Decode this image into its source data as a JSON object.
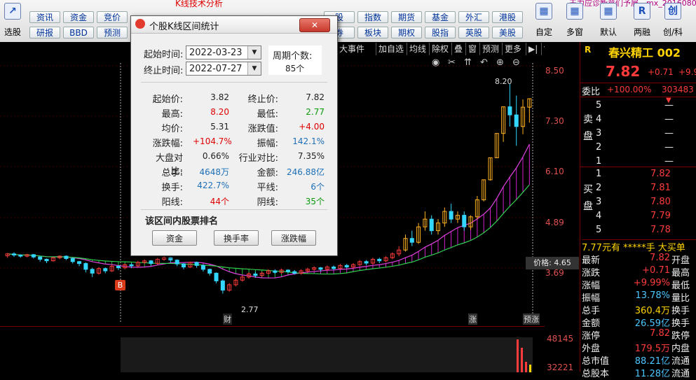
{
  "window_title": "K线技术分析",
  "toolbar": {
    "left_tool": {
      "label": "选股",
      "icon": "chart-line-icon"
    },
    "row1": [
      "资讯",
      "资金",
      "竞价",
      "",
      "",
      "股",
      "指数",
      "期货",
      "基金",
      "外汇",
      "港股"
    ],
    "row2": [
      "研报",
      "BBD",
      "预测",
      "",
      "",
      "券",
      "板块",
      "期权",
      "股指",
      "英股",
      "美股"
    ],
    "big": [
      {
        "label": "自定",
        "icon": "custom-layout-icon"
      },
      {
        "label": "多窗",
        "icon": "multi-window-icon"
      },
      {
        "label": "默认",
        "icon": "default-settings-icon"
      },
      {
        "label": "两融",
        "icon": "margin-trading-icon",
        "glyph": "R"
      },
      {
        "label": "创/科",
        "icon": "star-board-icon",
        "glyph": "创"
      }
    ],
    "top_right_text": "王力应诊断意们予展　mx_2016080"
  },
  "chart_controls": [
    "大事件",
    "加自选",
    "均线",
    "除权",
    "叠",
    "窗",
    "预测",
    "更多"
  ],
  "chart_icons": [
    "eye-icon",
    "scissors-icon",
    "up-arrows-icon",
    "undo-icon",
    "zoom-in-icon",
    "zoom-out-icon"
  ],
  "price_axis": [
    "8.50",
    "7.30",
    "6.10",
    "4.89",
    "3.69"
  ],
  "vol_axis": [
    "48145",
    "32221"
  ],
  "chart_labels": {
    "high_marker": "8.20",
    "low_marker": "2.77",
    "price_tip": "价格: 4.65",
    "b_marker": "B",
    "cai_marker": "财",
    "zhang_marker": "涨",
    "zhang2_marker": "预涨"
  },
  "chart_data": {
    "type": "candlestick",
    "y_range": [
      2.4,
      8.6
    ],
    "candles": [
      [
        3.75,
        3.8,
        3.7,
        3.82
      ],
      [
        3.8,
        3.77,
        3.72,
        3.84
      ],
      [
        3.77,
        3.74,
        3.7,
        3.79
      ],
      [
        3.74,
        3.78,
        3.71,
        3.8
      ],
      [
        3.78,
        3.72,
        3.68,
        3.8
      ],
      [
        3.72,
        3.66,
        3.6,
        3.74
      ],
      [
        3.66,
        3.62,
        3.56,
        3.68
      ],
      [
        3.62,
        3.7,
        3.6,
        3.72
      ],
      [
        3.7,
        3.74,
        3.66,
        3.76
      ],
      [
        3.74,
        3.68,
        3.64,
        3.76
      ],
      [
        3.68,
        3.6,
        3.55,
        3.7
      ],
      [
        3.6,
        3.55,
        3.48,
        3.62
      ],
      [
        3.55,
        3.4,
        3.32,
        3.58
      ],
      [
        3.4,
        3.3,
        3.2,
        3.44
      ],
      [
        3.3,
        3.42,
        3.26,
        3.46
      ],
      [
        3.42,
        3.36,
        3.3,
        3.45
      ],
      [
        3.36,
        3.48,
        3.33,
        3.52
      ],
      [
        3.48,
        3.44,
        3.38,
        3.5
      ],
      [
        3.44,
        3.52,
        3.4,
        3.55
      ],
      [
        3.52,
        3.49,
        3.43,
        3.56
      ],
      [
        3.49,
        3.58,
        3.46,
        3.62
      ],
      [
        3.58,
        3.62,
        3.54,
        3.66
      ],
      [
        3.62,
        3.55,
        3.5,
        3.64
      ],
      [
        3.55,
        3.66,
        3.52,
        3.7
      ],
      [
        3.66,
        3.7,
        3.62,
        3.74
      ],
      [
        3.7,
        3.64,
        3.58,
        3.72
      ],
      [
        3.64,
        3.54,
        3.48,
        3.66
      ],
      [
        3.54,
        3.46,
        3.4,
        3.56
      ],
      [
        3.46,
        3.58,
        3.44,
        3.6
      ],
      [
        3.58,
        3.5,
        3.44,
        3.6
      ],
      [
        3.5,
        3.4,
        3.34,
        3.52
      ],
      [
        3.4,
        3.3,
        3.24,
        3.42
      ],
      [
        3.3,
        3.1,
        3.04,
        3.32
      ],
      [
        3.1,
        2.86,
        2.77,
        3.14
      ],
      [
        2.86,
        3.0,
        2.82,
        3.04
      ],
      [
        3.0,
        3.12,
        2.96,
        3.16
      ],
      [
        3.12,
        3.2,
        3.08,
        3.24
      ],
      [
        3.2,
        3.28,
        3.16,
        3.32
      ],
      [
        3.28,
        3.24,
        3.18,
        3.34
      ],
      [
        3.24,
        3.3,
        3.2,
        3.34
      ],
      [
        3.3,
        3.36,
        3.26,
        3.4
      ],
      [
        3.36,
        3.32,
        3.28,
        3.4
      ],
      [
        3.32,
        3.38,
        3.28,
        3.42
      ],
      [
        3.38,
        3.34,
        3.3,
        3.4
      ],
      [
        3.34,
        3.3,
        3.26,
        3.38
      ],
      [
        3.3,
        3.36,
        3.26,
        3.4
      ],
      [
        3.36,
        3.4,
        3.32,
        3.44
      ],
      [
        3.4,
        3.44,
        3.36,
        3.48
      ],
      [
        3.44,
        3.4,
        3.34,
        3.46
      ],
      [
        3.4,
        3.46,
        3.36,
        3.5
      ],
      [
        3.46,
        3.42,
        3.38,
        3.5
      ],
      [
        3.42,
        3.5,
        3.4,
        3.54
      ],
      [
        3.5,
        3.46,
        3.42,
        3.54
      ],
      [
        3.46,
        3.52,
        3.42,
        3.56
      ],
      [
        3.52,
        3.6,
        3.48,
        3.64
      ],
      [
        3.6,
        3.56,
        3.5,
        3.64
      ],
      [
        3.56,
        3.66,
        3.52,
        3.7
      ],
      [
        3.66,
        3.62,
        3.56,
        3.7
      ],
      [
        3.62,
        3.7,
        3.58,
        3.74
      ],
      [
        3.7,
        3.8,
        3.66,
        3.84
      ],
      [
        3.8,
        3.9,
        3.74,
        4.0
      ],
      [
        3.9,
        4.2,
        3.86,
        4.3
      ],
      [
        4.2,
        4.1,
        4.0,
        4.4
      ],
      [
        4.1,
        4.5,
        4.06,
        4.6
      ],
      [
        4.5,
        4.7,
        4.4,
        4.9
      ],
      [
        4.7,
        4.4,
        4.3,
        4.8
      ],
      [
        4.4,
        4.6,
        4.3,
        4.7
      ],
      [
        4.6,
        4.9,
        4.5,
        5.0
      ],
      [
        4.9,
        4.7,
        4.6,
        5.1
      ],
      [
        4.7,
        4.8,
        4.6,
        4.9
      ],
      [
        4.8,
        4.5,
        4.4,
        4.9
      ],
      [
        4.5,
        4.76,
        4.42,
        4.8
      ],
      [
        4.76,
        5.2,
        4.7,
        5.3
      ],
      [
        5.2,
        5.72,
        5.16,
        5.72
      ],
      [
        5.72,
        6.29,
        5.7,
        6.29
      ],
      [
        6.29,
        6.92,
        6.29,
        6.92
      ],
      [
        6.92,
        7.61,
        6.7,
        7.61
      ],
      [
        7.61,
        7.4,
        7.1,
        8.2
      ],
      [
        7.4,
        7.1,
        6.6,
        7.9
      ],
      [
        7.1,
        7.6,
        6.9,
        7.8
      ],
      [
        7.6,
        7.82,
        7.2,
        7.82
      ]
    ]
  },
  "dialog": {
    "title": "个股K线区间统计",
    "start_label": "起始时间:",
    "start_value": "2022-03-23",
    "end_label": "终止时间:",
    "end_value": "2022-07-27",
    "period_label": "周期个数:",
    "period_value": "85个",
    "stats": [
      {
        "l1": "起始价:",
        "v1": "3.82",
        "c1": "#222",
        "l2": "终止价:",
        "v2": "7.82",
        "c2": "#222"
      },
      {
        "l1": "最高:",
        "v1": "8.20",
        "c1": "#e00000",
        "l2": "最低:",
        "v2": "2.77",
        "c2": "#0a9a0a"
      },
      {
        "l1": "均价:",
        "v1": "5.31",
        "c1": "#222",
        "l2": "涨跌值:",
        "v2": "+4.00",
        "c2": "#e00000"
      },
      {
        "l1": "涨跌幅:",
        "v1": "+104.7%",
        "c1": "#e00000",
        "l2": "振幅:",
        "v2": "142.1%",
        "c2": "#1d6fb8"
      },
      {
        "l1": "大盘对比:",
        "v1": "0.66%",
        "c1": "#222",
        "l2": "行业对比:",
        "v2": "7.35%",
        "c2": "#222"
      },
      {
        "l1": "总手:",
        "v1": "4648万",
        "c1": "#1d6fb8",
        "l2": "金额:",
        "v2": "246.88亿",
        "c2": "#1d6fb8"
      },
      {
        "l1": "换手:",
        "v1": "422.7%",
        "c1": "#1d6fb8",
        "l2": "平线:",
        "v2": "6个",
        "c2": "#1d6fb8"
      },
      {
        "l1": "阳线:",
        "v1": "44个",
        "c1": "#e00000",
        "l2": "阴线:",
        "v2": "35个",
        "c2": "#0a9a0a"
      }
    ],
    "ranking_label": "该区间内股票排名",
    "buttons": [
      "资金",
      "换手率",
      "涨跌幅"
    ]
  },
  "quote": {
    "r_badge": "R",
    "name": "春兴精工 002",
    "price": "7.82",
    "change": "+0.71",
    "change_pct": "+9.9",
    "weibi_label": "委比",
    "weibi_value": "+100.00%",
    "weicha_value": "303483",
    "sell_label": "卖盘",
    "buy_label": "买盘",
    "sell_rows": [
      {
        "n": "5",
        "p": "—"
      },
      {
        "n": "4",
        "p": "—"
      },
      {
        "n": "3",
        "p": "—"
      },
      {
        "n": "2",
        "p": "—"
      },
      {
        "n": "1",
        "p": "—"
      }
    ],
    "buy_rows": [
      {
        "n": "1",
        "p": "7.82"
      },
      {
        "n": "2",
        "p": "7.81"
      },
      {
        "n": "3",
        "p": "7.80"
      },
      {
        "n": "4",
        "p": "7.79"
      },
      {
        "n": "5",
        "p": "7.78"
      }
    ],
    "ticker_line": "7.77元有 *****手 大买单",
    "details": [
      {
        "l": "最新",
        "v": "7.82",
        "c": "#ff3b3b",
        "l2": "开盘"
      },
      {
        "l": "涨跌",
        "v": "+0.71",
        "c": "#ff3b3b",
        "l2": "最高"
      },
      {
        "l": "涨幅",
        "v": "+9.99%",
        "c": "#ff3b3b",
        "l2": "最低"
      },
      {
        "l": "振幅",
        "v": "13.78%",
        "c": "#4cc6ff",
        "l2": "量比"
      },
      {
        "l": "总手",
        "v": "360.4万",
        "c": "#ffd400",
        "l2": "换手"
      },
      {
        "l": "金额",
        "v": "26.59亿",
        "c": "#4cc6ff",
        "l2": "换手"
      },
      {
        "l": "涨停",
        "v": "7.82",
        "c": "#ff3b3b",
        "l2": "跌停"
      },
      {
        "l": "外盘",
        "v": "179.5万",
        "c": "#ff3b3b",
        "l2": "内盘"
      },
      {
        "l": "总市值",
        "v": "88.21亿",
        "c": "#4cc6ff",
        "l2": "流通"
      },
      {
        "l": "总股本",
        "v": "11.28亿",
        "c": "#4cc6ff",
        "l2": "流通"
      }
    ]
  }
}
